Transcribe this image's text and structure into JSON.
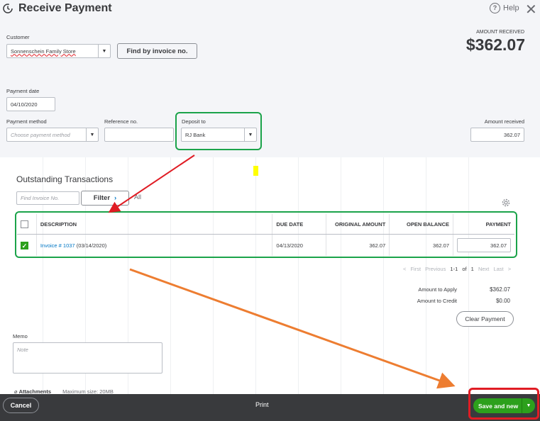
{
  "window": {
    "title": "Receive Payment",
    "help_label": "Help",
    "close_glyph": "✕"
  },
  "customer": {
    "label": "Customer",
    "value": "Sonnenschein Family Store",
    "find_button": "Find by invoice no."
  },
  "amount_received_header": {
    "label": "AMOUNT RECEIVED",
    "value": "$362.07"
  },
  "payment_date": {
    "label": "Payment date",
    "value": "04/10/2020"
  },
  "payment_method": {
    "label": "Payment method",
    "placeholder": "Choose payment method"
  },
  "reference": {
    "label": "Reference no.",
    "value": ""
  },
  "deposit_to": {
    "label": "Deposit to",
    "value": "RJ Bank"
  },
  "amount_received_field": {
    "label": "Amount received",
    "value": "362.07"
  },
  "outstanding": {
    "title": "Outstanding Transactions",
    "find_placeholder": "Find Invoice No.",
    "filter_label": "Filter",
    "all_label": "All",
    "columns": [
      "DESCRIPTION",
      "DUE DATE",
      "ORIGINAL AMOUNT",
      "OPEN BALANCE",
      "PAYMENT"
    ],
    "rows": [
      {
        "checked": true,
        "invoice_link": "Invoice # 1037",
        "invoice_date": "(03/14/2020)",
        "due_date": "04/13/2020",
        "original_amount": "362.07",
        "open_balance": "362.07",
        "payment": "362.07"
      }
    ],
    "pager": {
      "first": "< First",
      "previous": "Previous",
      "range": "1-1 of 1",
      "next": "Next",
      "last": "Last >"
    }
  },
  "summary": {
    "apply_label": "Amount to Apply",
    "apply_value": "$362.07",
    "credit_label": "Amount to Credit",
    "credit_value": "$0.00",
    "clear_button": "Clear Payment"
  },
  "memo": {
    "label": "Memo",
    "placeholder": "Note"
  },
  "attachments": {
    "label": "Attachments",
    "max_size": "Maximum size: 20MB"
  },
  "footer": {
    "cancel": "Cancel",
    "print": "Print",
    "save_and_new": "Save and new"
  },
  "colors": {
    "highlight_green": "#1ba34a",
    "highlight_red": "#e01c24",
    "arrow_red": "#e01c24",
    "arrow_orange": "#ed7d31",
    "marker_yellow": "#ffff00",
    "primary_green": "#2ca01c",
    "link_blue": "#0077c5"
  }
}
